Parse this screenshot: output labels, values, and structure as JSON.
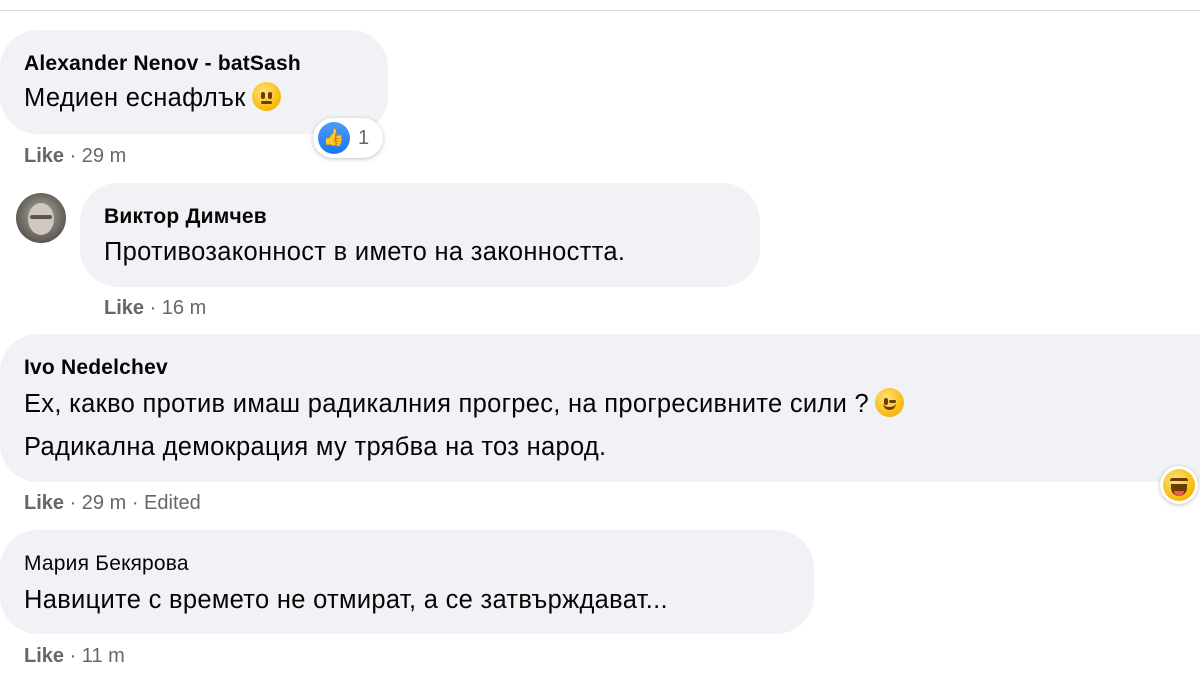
{
  "comments": [
    {
      "author": "Alexander Nenov - batSash",
      "text": "Медиен еснафлък",
      "emoji": "neutral-face-icon",
      "reaction": {
        "icon": "like-reaction-icon",
        "count": "1"
      },
      "like_label": "Like",
      "meta": "· 29 m"
    },
    {
      "author": "Виктор Димчев",
      "text": "Противозаконност в името на законността.",
      "like_label": "Like",
      "meta": "· 16 m"
    },
    {
      "author": "Ivo Nedelchev",
      "text_line1": "Ех, какво против имаш радикалния прогрес, на прогресивните сили ?",
      "text_line2": "Радикална демокрация му трябва на тоз народ.",
      "emoji": "winking-face-icon",
      "reaction": {
        "icon": "haha-reaction-icon"
      },
      "like_label": "Like",
      "meta": "· 29 m · Edited"
    },
    {
      "author": "Мария Бекярова",
      "text": "Навиците с времето не отмират, а се затвърждават...",
      "like_label": "Like",
      "meta": "· 11 m"
    }
  ],
  "colors": {
    "bubble": "#f0f2f5",
    "meta": "#65676b",
    "like_blue": "#1877f2"
  }
}
